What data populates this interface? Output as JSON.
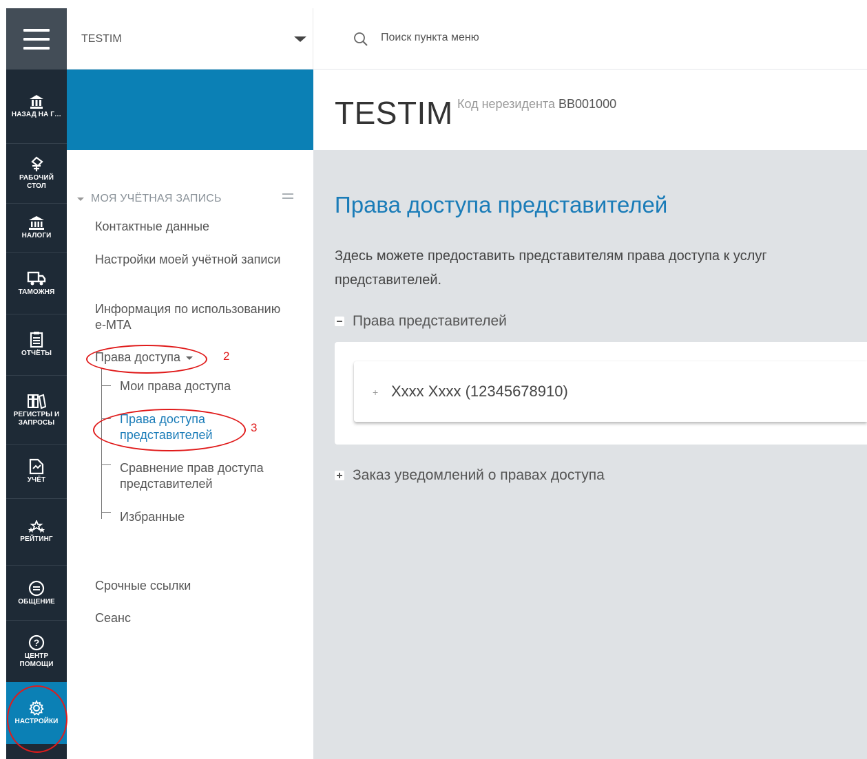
{
  "app": {
    "org_name": "TESTIM",
    "search_placeholder": "Поиск пункта меню"
  },
  "rail": {
    "items": [
      {
        "label": "НАЗАД НА Г…",
        "icon": "home-building-icon"
      },
      {
        "label": "РАБОЧИЙ\nСТОЛ",
        "icon": "desktop-icon"
      },
      {
        "label": "НАЛОГИ",
        "icon": "bank-icon"
      },
      {
        "label": "ТАМОЖНЯ",
        "icon": "truck-icon"
      },
      {
        "label": "ОТЧЁТЫ",
        "icon": "report-icon"
      },
      {
        "label": "РЕГИСТРЫ И\nЗАПРОСЫ",
        "icon": "binders-icon"
      },
      {
        "label": "УЧЁТ",
        "icon": "ledger-icon"
      },
      {
        "label": "РЕЙТИНГ",
        "icon": "stars-icon"
      },
      {
        "label": "ОБЩЕНИЕ",
        "icon": "chat-icon"
      },
      {
        "label": "ЦЕНТР\nПОМОЩИ",
        "icon": "help-icon"
      },
      {
        "label": "НАСТРОЙКИ",
        "icon": "gear-icon"
      }
    ]
  },
  "header": {
    "title": "TESTIM",
    "code_label": "Код нерезидента",
    "code_value": "BB001000"
  },
  "leftnav": {
    "section_title": "МОЯ УЧЁТНАЯ ЗАПИСЬ",
    "links": [
      "Контактные данные",
      "Настройки моей учётной записи",
      "Информация по использованию e-MTA",
      "Права доступа"
    ],
    "sub_links": [
      "Мои права доступа",
      "Права доступа представителей",
      "Сравнение прав доступа представителей",
      "Избранные"
    ],
    "bottom_links": [
      "Срочные ссылки",
      "Сеанс"
    ]
  },
  "annotations": [
    "2",
    "3"
  ],
  "main": {
    "page_title": "Права доступа представителей",
    "description": "Здесь можете предоставить представителям права доступа к услуг",
    "description_line2": "представителей.",
    "accordion_rights": "Права представителей",
    "representative": "Xxxx Xxxx (12345678910)",
    "accordion_notifications": "Заказ уведомлений о правах доступа"
  },
  "colors": {
    "rail": "#1e2a36",
    "accent": "#0b80b5",
    "link": "#1a7cb8",
    "main_bg": "#dfe2e5",
    "annotation": "#e01b1b"
  }
}
